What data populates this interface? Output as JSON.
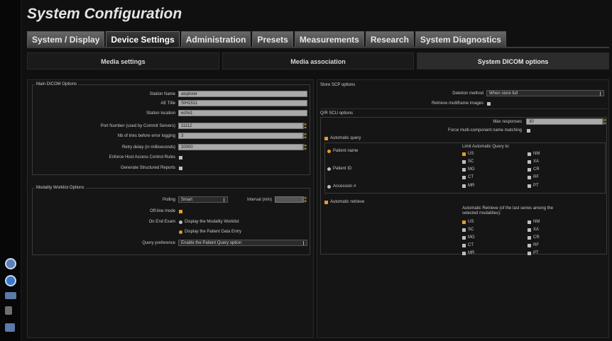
{
  "app": {
    "title": "System Configuration"
  },
  "tabs": [
    "System / Display",
    "Device Settings",
    "Administration",
    "Presets",
    "Measurements",
    "Research",
    "System Diagnostics"
  ],
  "subtabs": [
    "Media settings",
    "Media association",
    "System DICOM options"
  ],
  "left": {
    "main_dicom": {
      "title": "Main DICOM Options",
      "station_name": {
        "label": "Station Name",
        "value": "aixplorer"
      },
      "ae_title": {
        "label": "AE Title",
        "value": "SIH1511"
      },
      "station_location": {
        "label": "Station location",
        "value": "echo1"
      },
      "port_number": {
        "label": "Port Number (used by Commit Servers)",
        "value": "11112"
      },
      "nb_tries": {
        "label": "Nb of tries before error logging",
        "value": "3"
      },
      "retry_delay": {
        "label": "Retry delay (in milliseconds)",
        "value": "20000"
      },
      "enforce_host": {
        "label": "Enforce Host Access Control Rules"
      },
      "generate_sr": {
        "label": "Generate Structured Reports"
      }
    },
    "worklist": {
      "title": "Modality Worklist Options",
      "polling": {
        "label": "Polling",
        "value": "Smart"
      },
      "interval": {
        "label": "Interval (min)",
        "value": ""
      },
      "offline": {
        "label": "Off-line mode"
      },
      "on_end_exam": {
        "label": "On End Exam",
        "option1": "Display the Modality Worklist",
        "option2": "Display the Patient Data Entry"
      },
      "query_pref": {
        "label": "Query preference",
        "value": "Enable the Patient Query option"
      }
    }
  },
  "right": {
    "store_scp": {
      "title": "Store SCP options",
      "deletion": {
        "label": "Deletion method",
        "value": "When store full"
      },
      "retrieve_multiframe": {
        "label": "Retrieve multiframe images"
      }
    },
    "qr_scu": {
      "title": "Q/R SCU options",
      "max_responses": {
        "label": "Max responses",
        "value": "30"
      },
      "force_multi": {
        "label": "Force multi-component name matching"
      },
      "auto_query": "Automatic query",
      "patient_name": "Patient name",
      "patient_id": "Patient ID",
      "accession": "Accession #",
      "limit_title": "Limit Automatic Query to:",
      "modalities": [
        "US",
        "NM",
        "SC",
        "XA",
        "MG",
        "CR",
        "CT",
        "RF",
        "MR",
        "PT"
      ],
      "auto_retrieve": "Automatic retrieve",
      "retrieve_title": "Automatic Retrieve (of the last series among the selected modalities):"
    }
  }
}
